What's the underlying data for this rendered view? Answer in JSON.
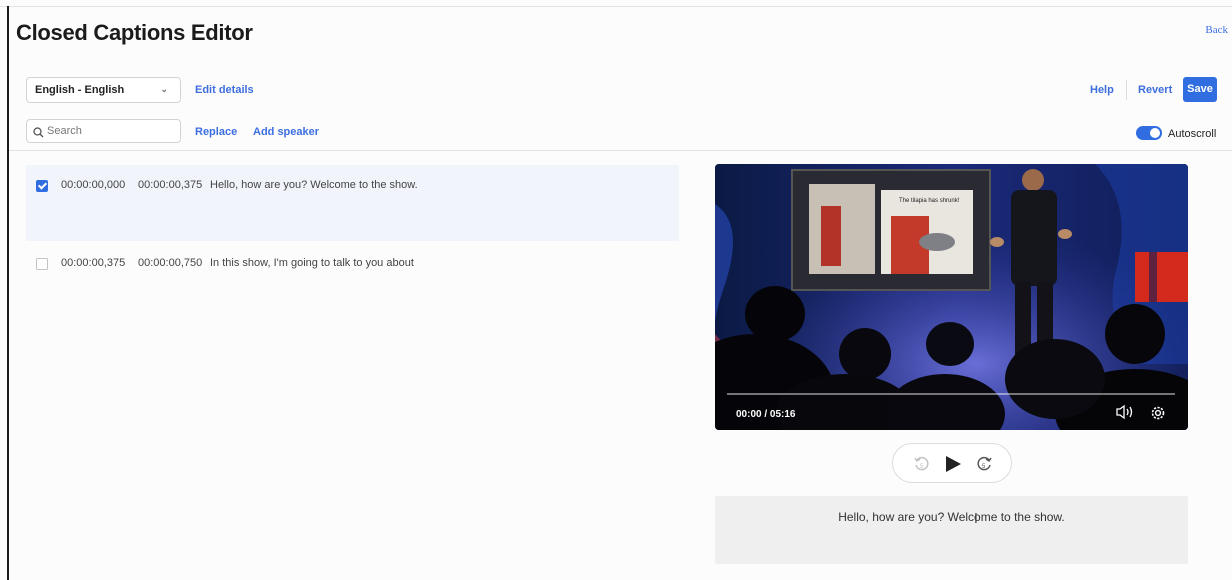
{
  "header": {
    "title": "Closed Captions Editor",
    "back_label": "Back"
  },
  "toolbar": {
    "language_value": "English - English",
    "edit_details_label": "Edit details",
    "help_label": "Help",
    "revert_label": "Revert",
    "save_label": "Save",
    "search_placeholder": "Search",
    "replace_label": "Replace",
    "add_speaker_label": "Add speaker",
    "autoscroll_label": "Autoscroll",
    "autoscroll_on": true
  },
  "captions": [
    {
      "selected": true,
      "start": "00:00:00,000",
      "end": "00:00:00,375",
      "text": "Hello, how are you? Welcome to the show."
    },
    {
      "selected": false,
      "start": "00:00:00,375",
      "end": "00:00:00,750",
      "text": "In this show, I'm going to talk to you about"
    }
  ],
  "player": {
    "time": "00:00 / 05:16",
    "slide_caption": "The tilapia has shrunk!",
    "progress": 0
  },
  "preview": {
    "text": "Hello, how are you? Welcome to the show."
  },
  "colors": {
    "accent": "#2f6de0",
    "link": "#3d6ee0",
    "selected_row": "#f1f4fb"
  }
}
